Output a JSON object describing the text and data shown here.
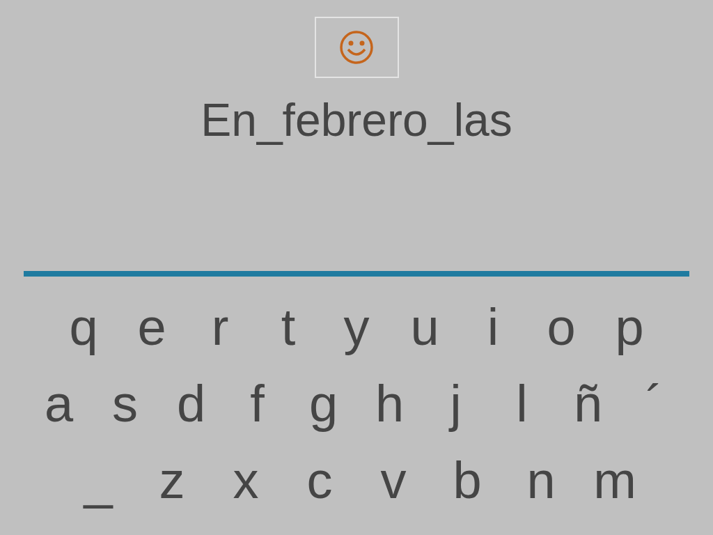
{
  "puzzle": {
    "text": "En_febrero_las"
  },
  "keyboard": [
    {
      "keys": [
        "q",
        "e",
        "r",
        "t",
        "y",
        "u",
        "i",
        "o",
        "p"
      ]
    },
    {
      "keys": [
        "a",
        "s",
        "d",
        "f",
        "g",
        "h",
        "j",
        "l",
        "ñ",
        "´"
      ]
    },
    {
      "keys": [
        "_",
        "z",
        "x",
        "c",
        "v",
        "b",
        "n",
        "m"
      ]
    }
  ]
}
